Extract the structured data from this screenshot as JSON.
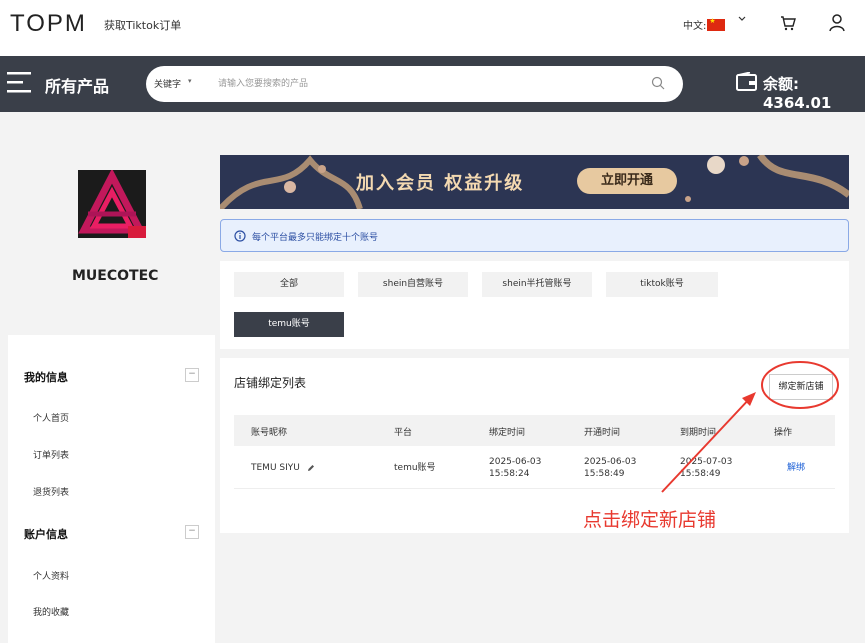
{
  "header": {
    "logo": "TOPM",
    "link": "获取Tiktok订单",
    "language": "中文:"
  },
  "nav": {
    "title": "所有产品",
    "search_type": "关键字",
    "search_placeholder": "请输入您要搜索的产品",
    "balance": "余额: 4364.01"
  },
  "profile": {
    "name": "MUECOTEC"
  },
  "sidebar": {
    "section1": {
      "title": "我的信息",
      "collapse": "−",
      "items": [
        "个人首页",
        "订单列表",
        "退货列表"
      ]
    },
    "section2": {
      "title": "账户信息",
      "collapse": "−",
      "items": [
        "个人资料",
        "我的收藏"
      ]
    }
  },
  "banner": {
    "text": "加入会员 权益升级",
    "button": "立即开通"
  },
  "notice": "每个平台最多只能绑定十个账号",
  "filters": [
    "全部",
    "shein自营账号",
    "shein半托管账号",
    "tiktok账号",
    "temu账号"
  ],
  "list": {
    "title": "店铺绑定列表",
    "bind_button": "绑定新店铺",
    "columns": [
      "账号昵称",
      "平台",
      "绑定时间",
      "开通时间",
      "到期时间",
      "操作"
    ],
    "rows": [
      {
        "nickname": "TEMU SIYU",
        "platform": "temu账号",
        "bind_date": "2025-06-03",
        "bind_time": "15:58:24",
        "open_date": "2025-06-03",
        "open_time": "15:58:49",
        "expire_date": "2025-07-03",
        "expire_time": "15:58:49",
        "action": "解绑"
      }
    ]
  },
  "annotation": "点击绑定新店铺",
  "colors": {
    "nav_bg": "#3a3f49",
    "annotation_red": "#e8392f",
    "link_blue": "#1b5fd6"
  }
}
